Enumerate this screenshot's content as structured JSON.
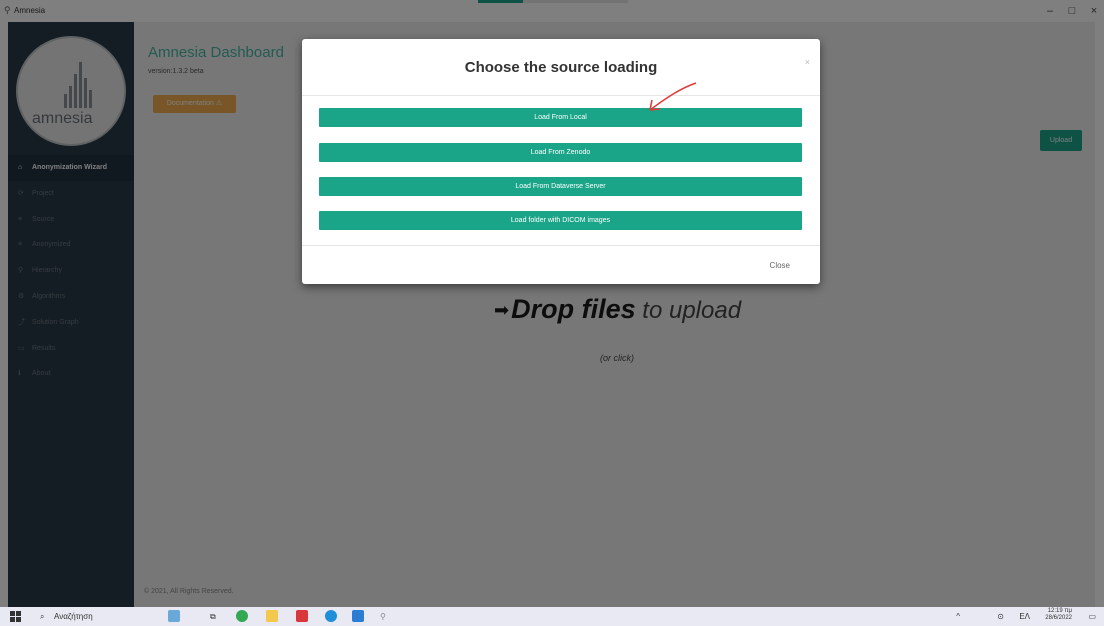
{
  "window": {
    "title": "Amnesia",
    "minimize": "–",
    "maximize": "□",
    "close": "×",
    "loading_fraction": 0.3
  },
  "sidebar": {
    "logo_text": "amnesia",
    "items": [
      {
        "label": "Anonymization Wizard",
        "icon": "home-icon",
        "glyph": "⌂"
      },
      {
        "label": "Project",
        "icon": "refresh-icon",
        "glyph": "⟳"
      },
      {
        "label": "Source",
        "icon": "database-icon",
        "glyph": "≡"
      },
      {
        "label": "Anonymized",
        "icon": "database-icon",
        "glyph": "≡"
      },
      {
        "label": "Hierarchy",
        "icon": "hierarchy-icon",
        "glyph": "⚲"
      },
      {
        "label": "Algorithms",
        "icon": "algorithm-icon",
        "glyph": "⚙"
      },
      {
        "label": "Solution Graph",
        "icon": "graph-icon",
        "glyph": "⤴"
      },
      {
        "label": "Results",
        "icon": "results-icon",
        "glyph": "▭"
      },
      {
        "label": "About",
        "icon": "info-icon",
        "glyph": "ℹ"
      }
    ]
  },
  "main": {
    "title": "Amnesia Dashboard",
    "version": "version:1.3.2 beta",
    "orange_button": "Documentation ⚠",
    "upload_button": "Upload",
    "drop_main": "Drop files",
    "drop_rest": " to upload",
    "drop_sub": "(or click)",
    "footer": "© 2021, All Rights Reserved."
  },
  "modal": {
    "title": "Choose the source loading",
    "close_x": "×",
    "buttons": [
      "Load From Local",
      "Load From Zenodo",
      "Load From Dataverse Server",
      "Load folder with DICOM images"
    ],
    "close_button": "Close"
  },
  "taskbar": {
    "search_placeholder": "Αναζήτηση",
    "tray_language": "ΕΛ",
    "tray_time": "12:19 πμ",
    "tray_date": "28/6/2022"
  },
  "colors": {
    "accent": "#1aa589",
    "orange": "#f0ad4e",
    "sidebar": "#2b3b48"
  }
}
